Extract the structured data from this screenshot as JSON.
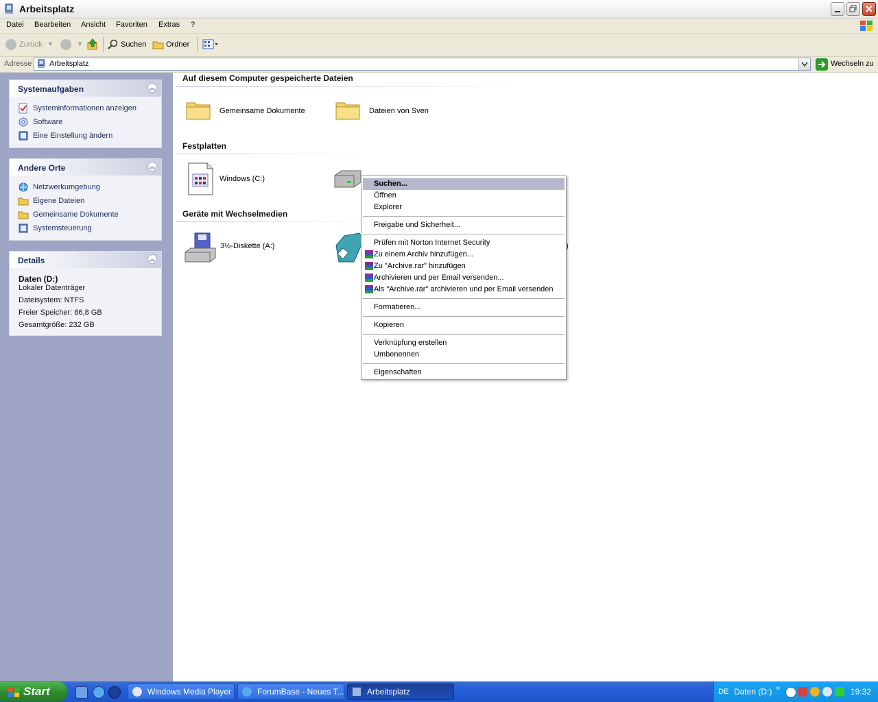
{
  "window": {
    "title": "Arbeitsplatz"
  },
  "menubar": {
    "items": [
      "Datei",
      "Bearbeiten",
      "Ansicht",
      "Favoriten",
      "Extras",
      "?"
    ]
  },
  "toolbar": {
    "back": "Zurück",
    "search": "Suchen",
    "folders": "Ordner"
  },
  "address": {
    "label": "Adresse",
    "value": "Arbeitsplatz",
    "go": "Wechseln zu"
  },
  "left": {
    "system_tasks": {
      "title": "Systemaufgaben",
      "items": [
        "Systeminformationen anzeigen",
        "Software",
        "Eine Einstellung ändern"
      ]
    },
    "other_places": {
      "title": "Andere Orte",
      "items": [
        "Netzwerkumgebung",
        "Eigene Dateien",
        "Gemeinsame Dokumente",
        "Systemsteuerung"
      ]
    },
    "details": {
      "title": "Details",
      "name": "Daten (D:)",
      "type": "Lokaler Datenträger",
      "filesystem": "Dateisystem: NTFS",
      "free": "Freier Speicher: 86,8 GB",
      "total": "Gesamtgröße: 232 GB"
    }
  },
  "main": {
    "groups": [
      {
        "title": "Auf diesem Computer gespeicherte Dateien",
        "items": [
          "Gemeinsame Dokumente",
          "Dateien von Sven"
        ]
      },
      {
        "title": "Festplatten",
        "items": [
          "Windows (C:)",
          ""
        ]
      },
      {
        "title": "Geräte mit Wechselmedien",
        "items": [
          "3½-Diskette (A:)",
          ":)"
        ]
      }
    ]
  },
  "context_menu": {
    "items": [
      {
        "label": "Suchen...",
        "selected": true
      },
      {
        "label": "Öffnen"
      },
      {
        "label": "Explorer"
      },
      {
        "sep": true
      },
      {
        "label": "Freigabe und Sicherheit..."
      },
      {
        "sep": true
      },
      {
        "label": "Prüfen mit Norton Internet Security"
      },
      {
        "label": "Zu einem Archiv hinzufügen...",
        "rar": true
      },
      {
        "label": "Zu \"Archive.rar\" hinzufügen",
        "rar": true
      },
      {
        "label": "Archivieren und per Email versenden...",
        "rar": true
      },
      {
        "label": "Als \"Archive.rar\" archivieren und per Email versenden",
        "rar": true
      },
      {
        "sep": true
      },
      {
        "label": "Formatieren..."
      },
      {
        "sep": true
      },
      {
        "label": "Kopieren"
      },
      {
        "sep": true
      },
      {
        "label": "Verknüpfung erstellen"
      },
      {
        "label": "Umbenennen"
      },
      {
        "sep": true
      },
      {
        "label": "Eigenschaften"
      }
    ]
  },
  "taskbar": {
    "start": "Start",
    "tasks": [
      "Windows Media Player",
      "ForumBase - Neues T...",
      "Arbeitsplatz"
    ],
    "lang": "DE",
    "tray_label": "Daten (D:)",
    "clock": "19:32"
  },
  "colors": {
    "accent": "#316ac5",
    "taskbar": "#245ed9",
    "start": "#2b8a2b",
    "menu_bg": "#ece9d8"
  }
}
